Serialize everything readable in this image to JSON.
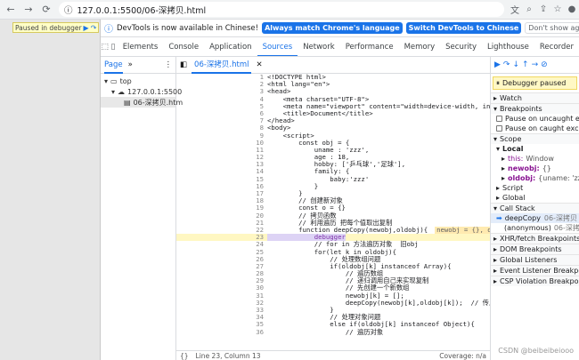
{
  "browser": {
    "url": "127.0.0.1:5500/06-深拷贝.html"
  },
  "page": {
    "paused_label": "Paused in debugger"
  },
  "infobar": {
    "message": "DevTools is now available in Chinese!",
    "btn_match": "Always match Chrome's language",
    "btn_switch": "Switch DevTools to Chinese",
    "btn_dont": "Don't show again"
  },
  "tabs": [
    "Elements",
    "Console",
    "Application",
    "Sources",
    "Network",
    "Performance",
    "Memory",
    "Security",
    "Lighthouse",
    "Recorder"
  ],
  "active_tab": "Sources",
  "navigator": {
    "tab": "Page",
    "tree": [
      "top",
      "127.0.0.1:5500",
      "06-深拷贝.htm"
    ]
  },
  "editor": {
    "file_tab": "06-深拷贝.html",
    "lines": [
      "<!DOCTYPE html>",
      "<html lang=\"en\">",
      "<head>",
      "    <meta charset=\"UTF-8\">",
      "    <meta name=\"viewport\" content=\"width=device-width, initial-scale=1.0\">",
      "    <title>Document</title>",
      "</head>",
      "<body>",
      "    <script>",
      "        const obj = {",
      "            uname : 'zzz',",
      "            age : 18,",
      "            hobby: ['乒乓球','足球'],",
      "            family: {",
      "                baby:'zzz'",
      "            }",
      "        }",
      "        // 创建新对象",
      "        const o = {}",
      "        // 拷贝函数",
      "        // 利用遍历 把每个值取出复制",
      "        function deepCopy(newobj,oldobj){",
      "            debugger",
      "            // for in 方法遍历对象  旧obj",
      "            for(let k in oldobj){",
      "                // 处理数组问题",
      "                if(oldobj[k] instanceof Array){",
      "                    // 遍历数组",
      "                    // 递归调用自己来实现复制",
      "                    // 先创建一个新数组",
      "                    newobj[k] = [];",
      "                    deepCopy(newobj[k],oldobj[k]);  // 传入的参数是数组",
      "                }",
      "                // 处理对象问题",
      "                else if(oldobj[k] instanceof Object){",
      "                    // 遍历对象"
    ],
    "inline_value": "newobj = {}, oldobj = {uname: 'zzz', ag",
    "status": "Line 23, Column 13",
    "coverage": "Coverage: n/a"
  },
  "debugger": {
    "paused_text": "Debugger paused",
    "watch": "Watch",
    "breakpoints": "Breakpoints",
    "pause_uncaught": "Pause on uncaught exceptions",
    "pause_caught": "Pause on caught exceptions",
    "scope": "Scope",
    "local": "Local",
    "this_key": "this:",
    "this_val": "Window",
    "newobj_key": "newobj:",
    "newobj_val": "{}",
    "oldobj_key": "oldobj:",
    "oldobj_val": "{uname: 'zzz'",
    "script": "Script",
    "global": "Global",
    "call_stack": "Call Stack",
    "frames": [
      {
        "name": "deepCopy",
        "loc": "06-深拷贝"
      },
      {
        "name": "(anonymous)",
        "loc": "06-深拷贝"
      }
    ],
    "xhr": "XHR/fetch Breakpoints",
    "dom": "DOM Breakpoints",
    "global_listeners": "Global Listeners",
    "event_listeners": "Event Listener Breakpoints",
    "csp": "CSP Violation Breakpoints"
  },
  "watermark": "CSDN @beibeibeiooo"
}
